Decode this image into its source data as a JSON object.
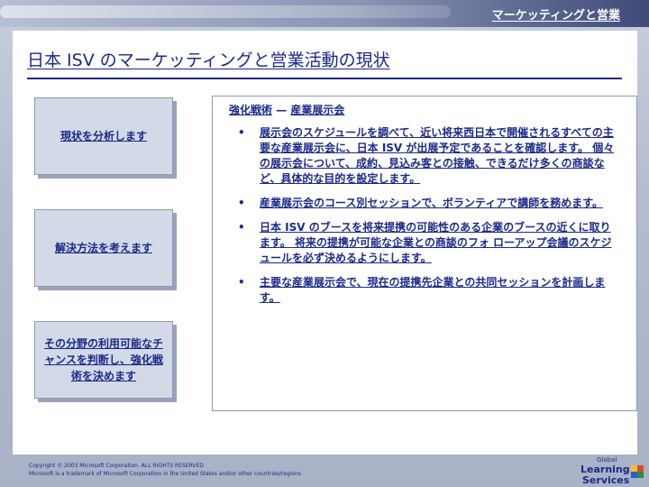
{
  "header": {
    "title": "マーケッティングと営業"
  },
  "page": {
    "title": "日本 ISV のマーケッティングと営業活動の現状"
  },
  "steps": [
    {
      "label": "現状を分析します"
    },
    {
      "label": "解決方法を考えます"
    },
    {
      "label": "その分野の利用可能なチャンスを判断し、強化戦術を決めます"
    }
  ],
  "content": {
    "title_left": "強化戦術",
    "title_dash": "—",
    "title_right": "産業展示会",
    "bullets": [
      "展示会のスケジュールを調べて、近い将来西日本で開催されるすべての主要な産業展示会に、日本 ISV が出展予定であることを確認します。 個々の展示会について、成約、見込み客との接触、できるだけ多くの商談など、具体的な目的を設定します。",
      "産業展示会のコース別セッションで、ボランティアで講師を務めます。",
      "日本 ISV のブースを将来提携の可能性のある企業のブースの近くに取ります。 将来の提携が可能な企業との商談のフォ ローアップ会議のスケジュールを必ず決めるようにします。",
      "主要な産業展示会で、現在の提携先企業との共同セッションを計画します。"
    ]
  },
  "footer": {
    "line1": "Copyright © 2003 Microsoft Corporation. ALL RIGHTS RESERVED",
    "line2": "Microsoft is a trademark of Microsoft Corporation in the United States and/or other countries/regions"
  },
  "logo": {
    "line1": "Global",
    "line2": "Learning",
    "line3": "Services"
  }
}
